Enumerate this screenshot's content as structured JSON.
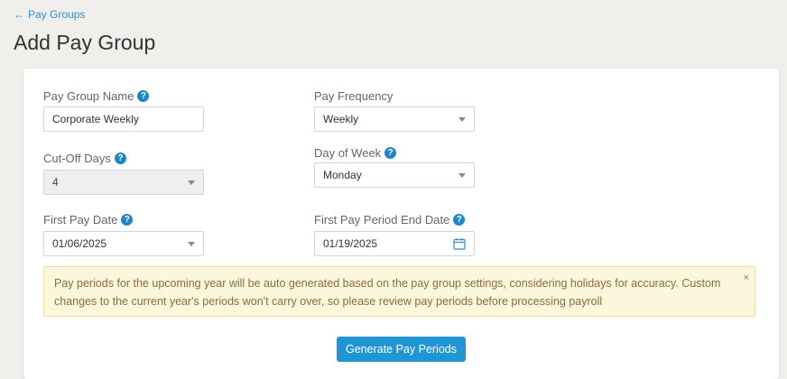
{
  "nav": {
    "back_label": "Pay Groups"
  },
  "page": {
    "title": "Add Pay Group"
  },
  "form": {
    "pay_group_name": {
      "label": "Pay Group Name",
      "value": "Corporate Weekly"
    },
    "pay_frequency": {
      "label": "Pay Frequency",
      "value": "Weekly"
    },
    "cut_off_days": {
      "label": "Cut-Off Days",
      "value": "4"
    },
    "day_of_week": {
      "label": "Day of Week",
      "value": "Monday"
    },
    "first_pay_date": {
      "label": "First Pay Date",
      "value": "01/06/2025"
    },
    "first_pay_period_end_date": {
      "label": "First Pay Period End Date",
      "value": "01/19/2025"
    }
  },
  "alert": {
    "message": "Pay periods for the upcoming year will be auto generated based on the pay group settings, considering holidays for accuracy. Custom changes to the current year's periods won't carry over, so please review pay periods before processing payroll",
    "close_glyph": "×"
  },
  "actions": {
    "generate_label": "Generate Pay Periods"
  },
  "icons": {
    "help_glyph": "?",
    "back_arrow": "←"
  },
  "colors": {
    "accent": "#1f96d3",
    "alert_bg": "#fcf6dc",
    "alert_text": "#8a6d3b",
    "page_bg": "#f1efeb"
  }
}
